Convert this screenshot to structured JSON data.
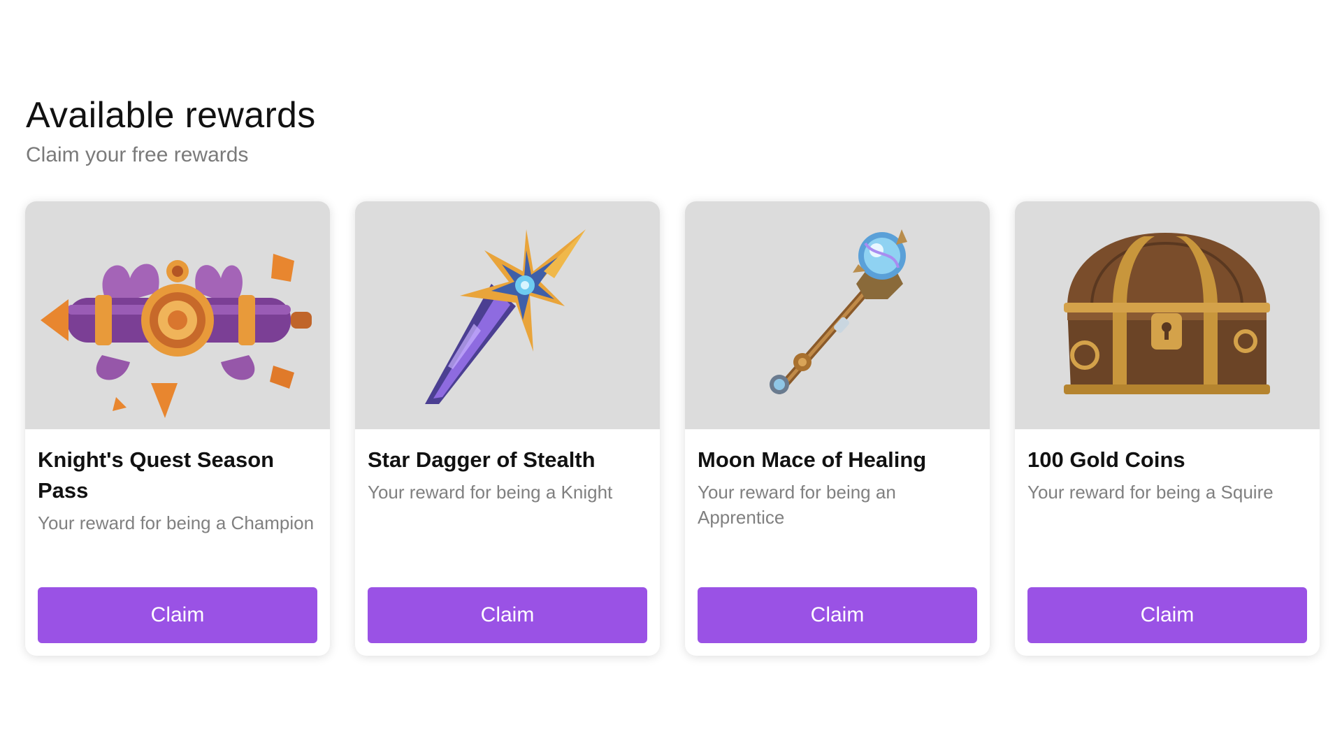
{
  "header": {
    "title": "Available rewards",
    "subtitle": "Claim your free rewards"
  },
  "rewards": [
    {
      "title": "Knight's Quest Season Pass",
      "description": "Your reward for being a Champion",
      "button_label": "Claim",
      "image": "season-pass-scroll"
    },
    {
      "title": "Star Dagger of Stealth",
      "description": "Your reward for being a Knight",
      "button_label": "Claim",
      "image": "star-dagger"
    },
    {
      "title": "Moon Mace of Healing",
      "description": "Your reward for being an Apprentice",
      "button_label": "Claim",
      "image": "moon-mace"
    },
    {
      "title": "100 Gold Coins",
      "description": "Your reward for being a Squire",
      "button_label": "Claim",
      "image": "treasure-chest"
    }
  ],
  "colors": {
    "accent": "#9a52e5",
    "image_background": "#dcdcdc",
    "muted_text": "#808080"
  }
}
